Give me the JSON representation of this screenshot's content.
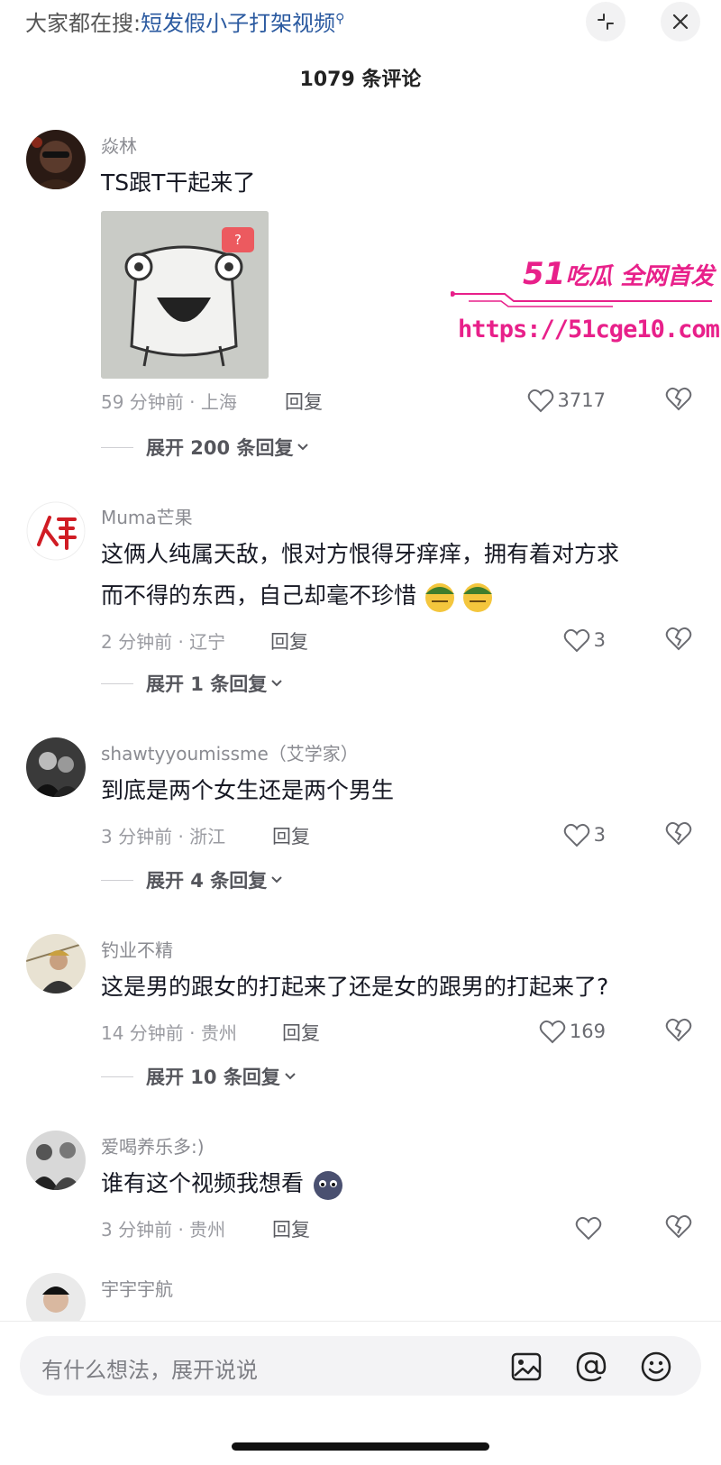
{
  "search_bar": {
    "prefix": "大家都在搜:",
    "term": "短发假小子打架视频",
    "search_glyph": "⚲"
  },
  "comments_header": {
    "count_label": "1079 条评论"
  },
  "comments": [
    {
      "username": "焱林",
      "text_lines": [
        "TS跟T干起来了"
      ],
      "has_sticker": true,
      "sticker_badge": "?",
      "time_location": "59 分钟前 · 上海",
      "reply_label": "回复",
      "likes": "3717",
      "expand_label": "展开 200 条回复"
    },
    {
      "username": "Muma芒果",
      "text_lines": [
        "这俩人纯属天敌，恨对方恨得牙痒痒，拥有着对方求",
        "而不得的东西，自己却毫不珍惜"
      ],
      "time_location": "2 分钟前 · 辽宁",
      "reply_label": "回复",
      "likes": "3",
      "expand_label": "展开 1 条回复"
    },
    {
      "username": "shawtyyoumissme（艾学家）",
      "text_lines": [
        "到底是两个女生还是两个男生"
      ],
      "time_location": "3 分钟前 · 浙江",
      "reply_label": "回复",
      "likes": "3",
      "expand_label": "展开 4 条回复"
    },
    {
      "username": "钓业不精",
      "text_lines": [
        "这是男的跟女的打起来了还是女的跟男的打起来了?"
      ],
      "time_location": "14 分钟前 · 贵州",
      "reply_label": "回复",
      "likes": "169",
      "expand_label": "展开 10 条回复"
    },
    {
      "username": "爱喝养乐多:)",
      "text_lines": [
        "谁有这个视频我想看"
      ],
      "time_location": "3 分钟前 · 贵州",
      "reply_label": "回复",
      "likes": ""
    },
    {
      "username": "宇宇宇航"
    }
  ],
  "watermark": {
    "brand": "51吃瓜 全网首发",
    "brand_num": "51",
    "brand_rest": "吃瓜 全网首发",
    "url": "https://51cge10.com"
  },
  "input_bar": {
    "placeholder": "有什么想法，展开说说"
  },
  "icons": {
    "collapse": "collapse-icon",
    "close": "close-icon",
    "like": "heart-outline-icon",
    "dislike": "broken-heart-icon",
    "image": "image-icon",
    "mention": "at-icon",
    "emoji": "emoji-icon"
  },
  "colors": {
    "search_term": "#2b5aa0",
    "watermark": "#e8208a",
    "text_primary": "#161823",
    "text_secondary": "#8a8b91"
  }
}
